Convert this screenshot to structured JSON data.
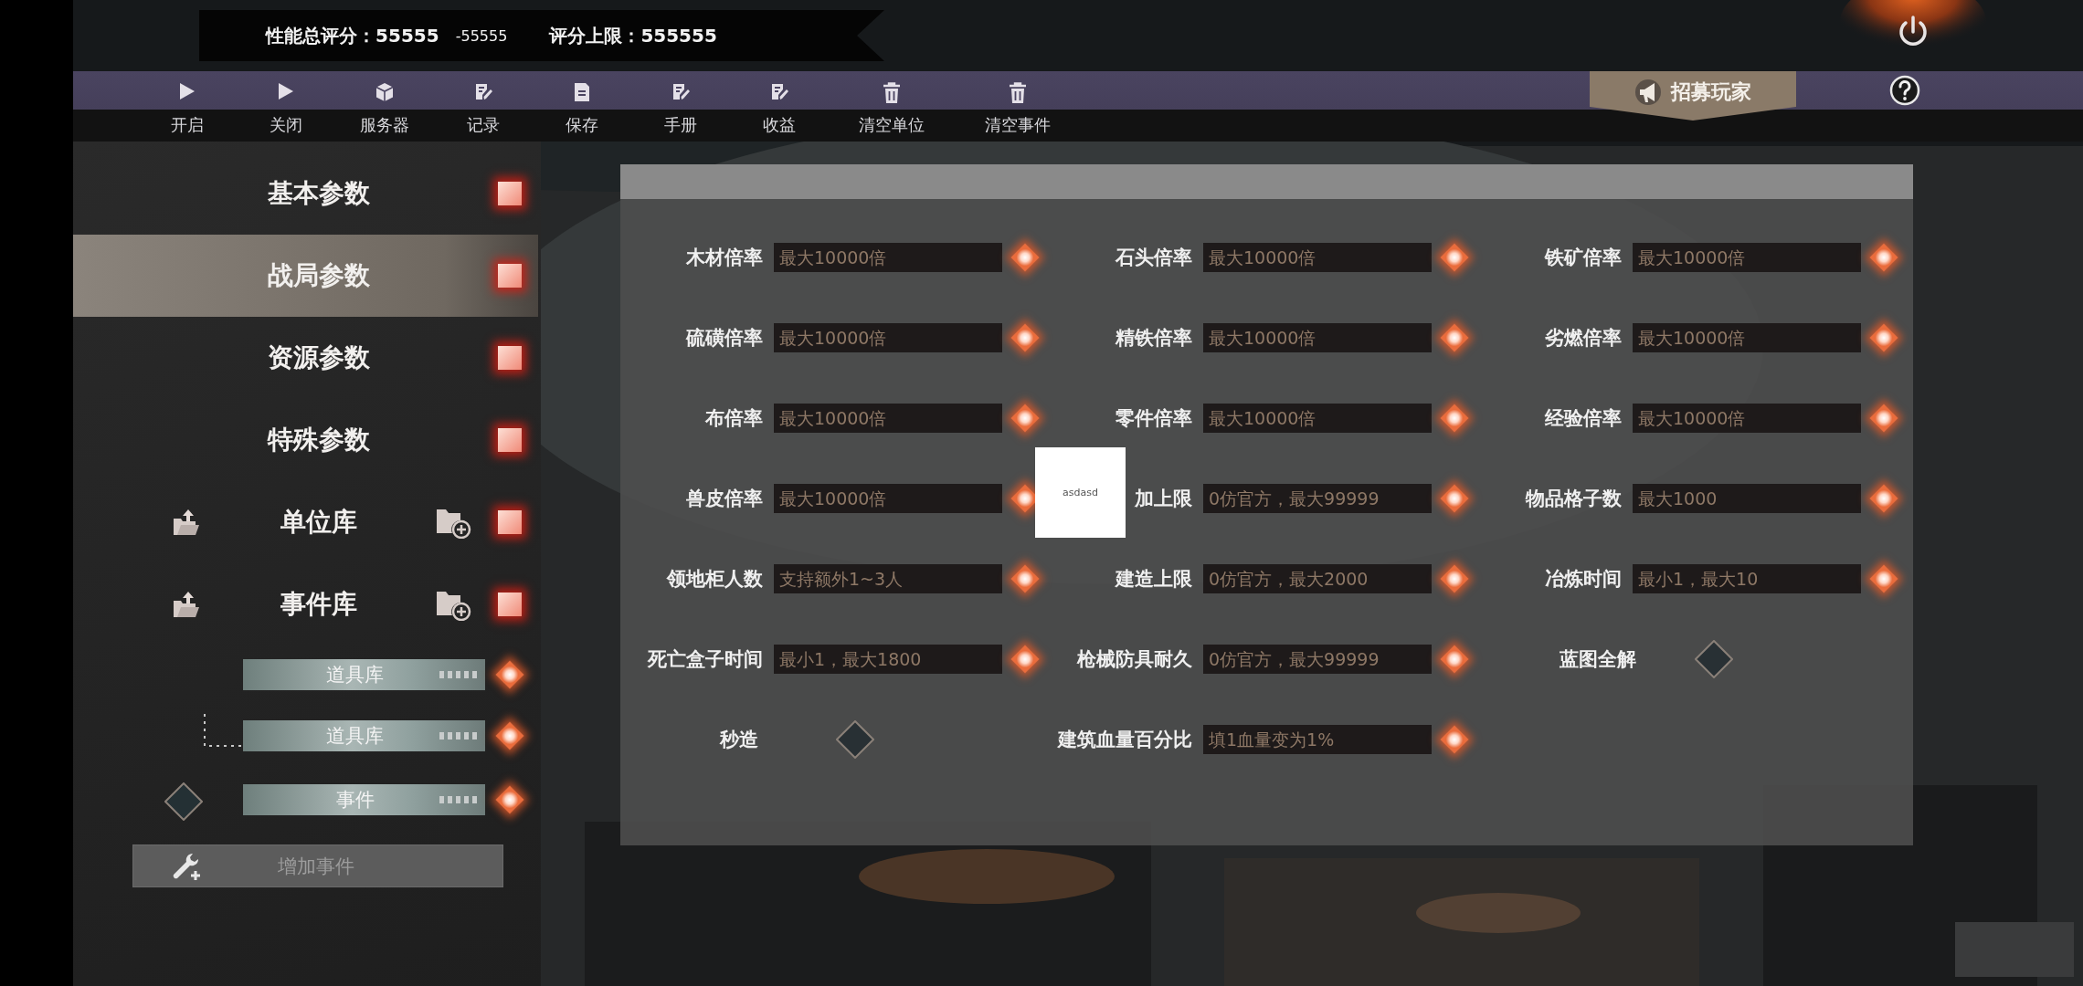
{
  "score_banner": {
    "total": "性能总评分：55555",
    "delta": "-55555",
    "limit": "评分上限：555555"
  },
  "toolbar": {
    "items": [
      {
        "kind": "play",
        "label": "开启"
      },
      {
        "kind": "play",
        "label": "关闭"
      },
      {
        "kind": "box",
        "label": "服务器"
      },
      {
        "kind": "edit",
        "label": "记录"
      },
      {
        "kind": "document",
        "label": "保存"
      },
      {
        "kind": "edit",
        "label": "手册"
      },
      {
        "kind": "edit",
        "label": "收益"
      },
      {
        "kind": "trash",
        "label": "清空单位"
      },
      {
        "kind": "trash",
        "label": "清空事件"
      }
    ],
    "recruit_button": "招募玩家"
  },
  "sidebar": {
    "items": [
      {
        "kind": "section",
        "label": "基本参数",
        "selected": false
      },
      {
        "kind": "section",
        "label": "战局参数",
        "selected": true
      },
      {
        "kind": "section",
        "label": "资源参数",
        "selected": false
      },
      {
        "kind": "section",
        "label": "特殊参数",
        "selected": false
      },
      {
        "kind": "library",
        "label": "单位库",
        "selected": false
      },
      {
        "kind": "library",
        "label": "事件库",
        "selected": false
      }
    ],
    "tree": [
      {
        "kind": "node",
        "label": "道具库"
      },
      {
        "kind": "branch",
        "label": "道具库"
      },
      {
        "kind": "toggle",
        "label": "事件",
        "checked": false
      }
    ],
    "add_button": "增加事件"
  },
  "form": {
    "fields": [
      {
        "kind": "input",
        "label": "木材倍率",
        "placeholder": "最大10000倍"
      },
      {
        "kind": "input",
        "label": "石头倍率",
        "placeholder": "最大10000倍"
      },
      {
        "kind": "input",
        "label": "铁矿倍率",
        "placeholder": "最大10000倍"
      },
      {
        "kind": "input",
        "label": "硫磺倍率",
        "placeholder": "最大10000倍"
      },
      {
        "kind": "input",
        "label": "精铁倍率",
        "placeholder": "最大10000倍"
      },
      {
        "kind": "input",
        "label": "劣燃倍率",
        "placeholder": "最大10000倍"
      },
      {
        "kind": "input",
        "label": "布倍率",
        "placeholder": "最大10000倍"
      },
      {
        "kind": "input",
        "label": "零件倍率",
        "placeholder": "最大10000倍"
      },
      {
        "kind": "input",
        "label": "经验倍率",
        "placeholder": "最大10000倍"
      },
      {
        "kind": "input",
        "label": "兽皮倍率",
        "placeholder": "最大10000倍"
      },
      {
        "kind": "input",
        "label": "加上限",
        "placeholder": "0仿官方，最大99999"
      },
      {
        "kind": "input",
        "label": "物品格子数",
        "placeholder": "最大1000"
      },
      {
        "kind": "input",
        "label": "领地柜人数",
        "placeholder": "支持额外1~3人"
      },
      {
        "kind": "input",
        "label": "建造上限",
        "placeholder": "0仿官方，最大2000"
      },
      {
        "kind": "input",
        "label": "冶炼时间",
        "placeholder": "最小1，最大10"
      },
      {
        "kind": "input",
        "label": "死亡盒子时间",
        "placeholder": "最小1，最大1800"
      },
      {
        "kind": "input",
        "label": "枪械防具耐久",
        "placeholder": "0仿官方，最大99999"
      },
      {
        "kind": "toggle",
        "label": "蓝图全解",
        "checked": false
      },
      {
        "kind": "toggle",
        "label": "秒造",
        "checked": false
      },
      {
        "kind": "input",
        "label": "建筑血量百分比",
        "placeholder": "填1血量变为1%"
      }
    ],
    "overlay": "asdasd"
  }
}
